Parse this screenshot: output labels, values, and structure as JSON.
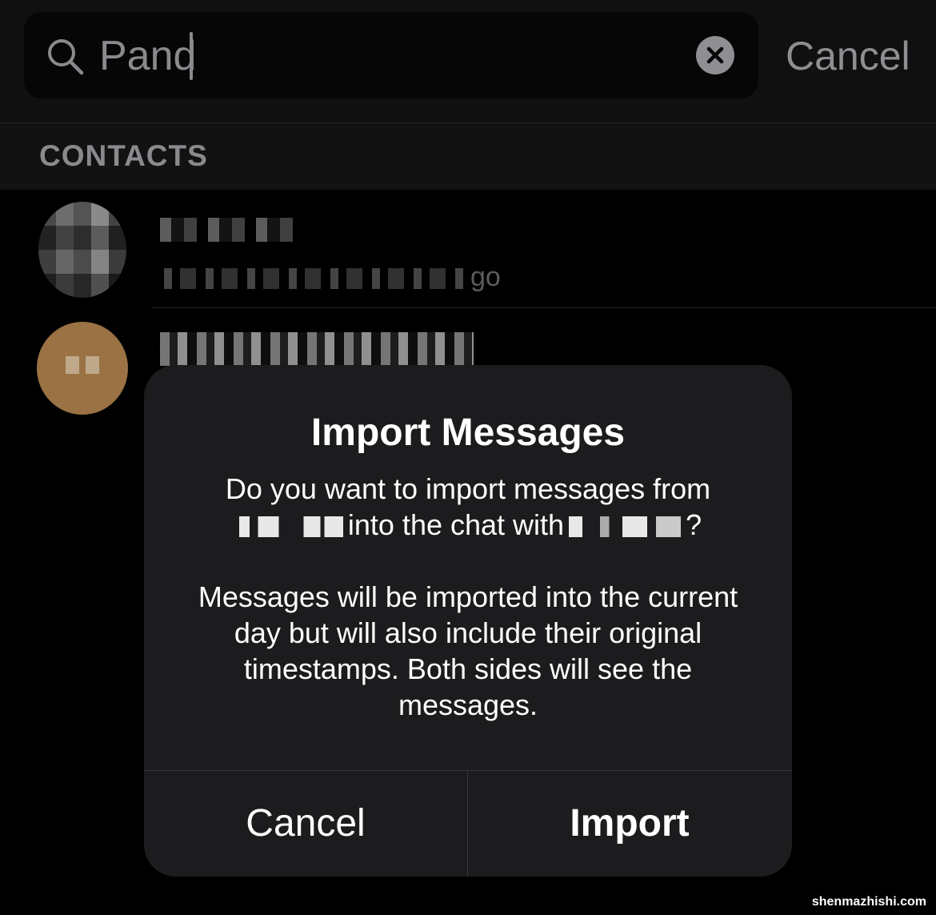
{
  "search": {
    "query": "Pand",
    "cancel_label": "Cancel",
    "icon": "search-icon",
    "clear_icon": "clear-icon"
  },
  "section": {
    "title": "CONTACTS"
  },
  "contacts": [
    {
      "subtitle_tail": "go"
    }
  ],
  "alert": {
    "title": "Import Messages",
    "message_part1": "Do you want to import messages from",
    "message_part2": "into the chat with",
    "message_part3": "?",
    "message_body": "Messages will be imported into the current day but will also include their original timestamps. Both sides will see the messages.",
    "cancel_label": "Cancel",
    "import_label": "Import"
  },
  "watermark": "shenmazhishi.com",
  "colors": {
    "background": "#000000",
    "alert_background": "#1c1c1e",
    "secondary_text": "#8e8e93"
  }
}
